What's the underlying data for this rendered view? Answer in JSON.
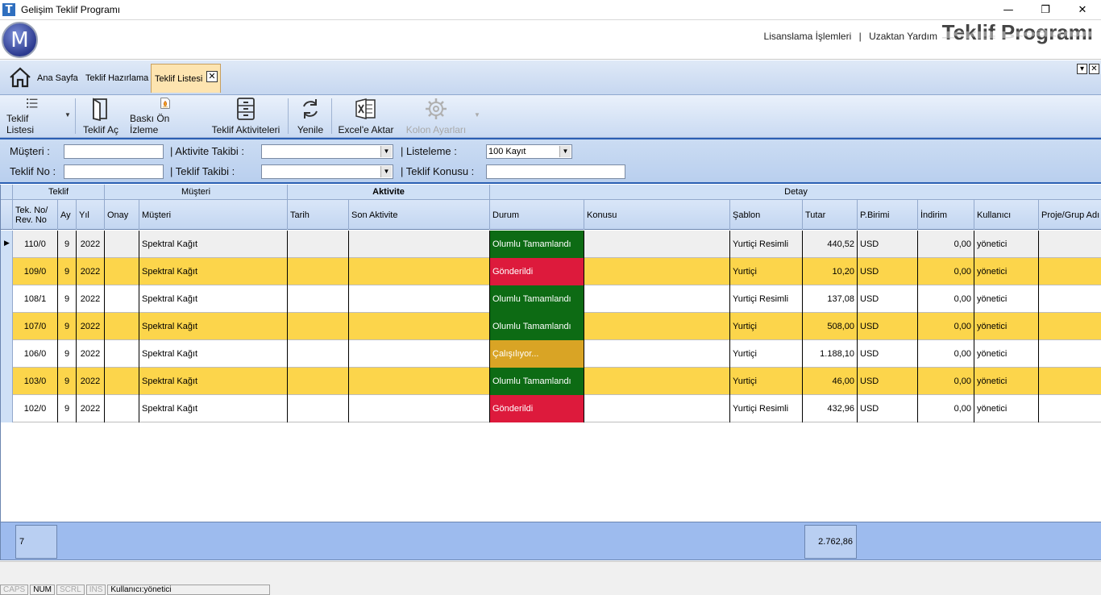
{
  "window": {
    "title": "Gelişim Teklif Programı",
    "app_icon_letter": "T",
    "minimize": "—",
    "restore": "❐",
    "close": "✕"
  },
  "header": {
    "logo_letter": "M",
    "links": [
      "Lisanslama İşlemleri",
      "|",
      "Uzaktan Yardım"
    ],
    "brand": "Teklif Programı"
  },
  "tabs": [
    {
      "label": "Ana Sayfa"
    },
    {
      "label": "Teklif Hazırlama"
    },
    {
      "label": "Teklif Listesi",
      "active": true
    }
  ],
  "toolbar": {
    "items": [
      {
        "label": "Teklif Listesi",
        "icon": "list-icon"
      },
      {
        "label": "Teklif Aç",
        "icon": "open-book-icon"
      },
      {
        "label": "Baskı Ön İzleme",
        "icon": "print-preview-icon"
      },
      {
        "label": "Teklif Aktiviteleri",
        "icon": "cabinet-icon"
      },
      {
        "label": "Yenile",
        "icon": "refresh-icon"
      },
      {
        "label": "Excel'e Aktar",
        "icon": "excel-icon"
      },
      {
        "label": "Kolon Ayarları",
        "icon": "gear-icon",
        "disabled": true
      }
    ]
  },
  "filters": {
    "musteri_label": "Müşteri :",
    "musteri_value": "",
    "aktivite_takibi_label": "| Aktivite Takibi :",
    "aktivite_takibi_value": "",
    "listeleme_label": "| Listeleme  :",
    "listeleme_value": "100 Kayıt",
    "teklif_no_label": "Teklif No :",
    "teklif_no_value": "",
    "teklif_takibi_label": "| Teklif Takibi :",
    "teklif_takibi_value": "",
    "teklif_konusu_label": "| Teklif Konusu :",
    "teklif_konusu_value": ""
  },
  "grid": {
    "bands": [
      "Teklif",
      "Müşteri",
      "Aktivite",
      "Detay"
    ],
    "columns": [
      "Tek. No/ Rev. No",
      "Ay",
      "Yıl",
      "Onay",
      "Müşteri",
      "Tarih",
      "Son Aktivite",
      "Durum",
      "Konusu",
      "Şablon",
      "Tutar",
      "P.Birimi",
      "İndirim",
      "Kullanıcı",
      "Proje/Grup Adı"
    ],
    "rows": [
      {
        "no": "110/0",
        "ay": "9",
        "yil": "2022",
        "onay": "",
        "musteri": "Spektral Kağıt",
        "tarih": "",
        "son_aktivite": "",
        "durum": "Olumlu Tamamlandı",
        "durum_color": "green",
        "konusu": "",
        "sablon": "Yurtiçi Resimli",
        "tutar": "440,52",
        "birim": "USD",
        "indirim": "0,00",
        "kullanici": "yönetici",
        "proje": ""
      },
      {
        "no": "109/0",
        "ay": "9",
        "yil": "2022",
        "onay": "",
        "musteri": "Spektral Kağıt",
        "tarih": "",
        "son_aktivite": "",
        "durum": "Gönderildi",
        "durum_color": "red",
        "konusu": "",
        "sablon": "Yurtiçi",
        "tutar": "10,20",
        "birim": "USD",
        "indirim": "0,00",
        "kullanici": "yönetici",
        "proje": ""
      },
      {
        "no": "108/1",
        "ay": "9",
        "yil": "2022",
        "onay": "",
        "musteri": "Spektral Kağıt",
        "tarih": "",
        "son_aktivite": "",
        "durum": "Olumlu Tamamlandı",
        "durum_color": "green",
        "konusu": "",
        "sablon": "Yurtiçi Resimli",
        "tutar": "137,08",
        "birim": "USD",
        "indirim": "0,00",
        "kullanici": "yönetici",
        "proje": ""
      },
      {
        "no": "107/0",
        "ay": "9",
        "yil": "2022",
        "onay": "",
        "musteri": "Spektral Kağıt",
        "tarih": "",
        "son_aktivite": "",
        "durum": "Olumlu Tamamlandı",
        "durum_color": "green",
        "konusu": "",
        "sablon": "Yurtiçi",
        "tutar": "508,00",
        "birim": "USD",
        "indirim": "0,00",
        "kullanici": "yönetici",
        "proje": ""
      },
      {
        "no": "106/0",
        "ay": "9",
        "yil": "2022",
        "onay": "",
        "musteri": "Spektral Kağıt",
        "tarih": "",
        "son_aktivite": "",
        "durum": "Çalışılıyor...",
        "durum_color": "orange",
        "konusu": "",
        "sablon": "Yurtiçi",
        "tutar": "1.188,10",
        "birim": "USD",
        "indirim": "0,00",
        "kullanici": "yönetici",
        "proje": ""
      },
      {
        "no": "103/0",
        "ay": "9",
        "yil": "2022",
        "onay": "",
        "musteri": "Spektral Kağıt",
        "tarih": "",
        "son_aktivite": "",
        "durum": "Olumlu Tamamlandı",
        "durum_color": "green",
        "konusu": "",
        "sablon": "Yurtiçi",
        "tutar": "46,00",
        "birim": "USD",
        "indirim": "0,00",
        "kullanici": "yönetici",
        "proje": ""
      },
      {
        "no": "102/0",
        "ay": "9",
        "yil": "2022",
        "onay": "",
        "musteri": "Spektral Kağıt",
        "tarih": "",
        "son_aktivite": "",
        "durum": "Gönderildi",
        "durum_color": "red",
        "konusu": "",
        "sablon": "Yurtiçi Resimli",
        "tutar": "432,96",
        "birim": "USD",
        "indirim": "0,00",
        "kullanici": "yönetici",
        "proje": ""
      }
    ],
    "footer": {
      "count": "7",
      "total": "2.762,86"
    }
  },
  "statusbar": {
    "caps": "CAPS",
    "num": "NUM",
    "scrl": "SCRL",
    "ins": "INS",
    "user": "Kullanıcı:yönetici"
  },
  "colors": {
    "green": "#0d6b14",
    "red": "#dd1a3c",
    "orange": "#d9a425",
    "alt_row": "#fcd54b"
  }
}
